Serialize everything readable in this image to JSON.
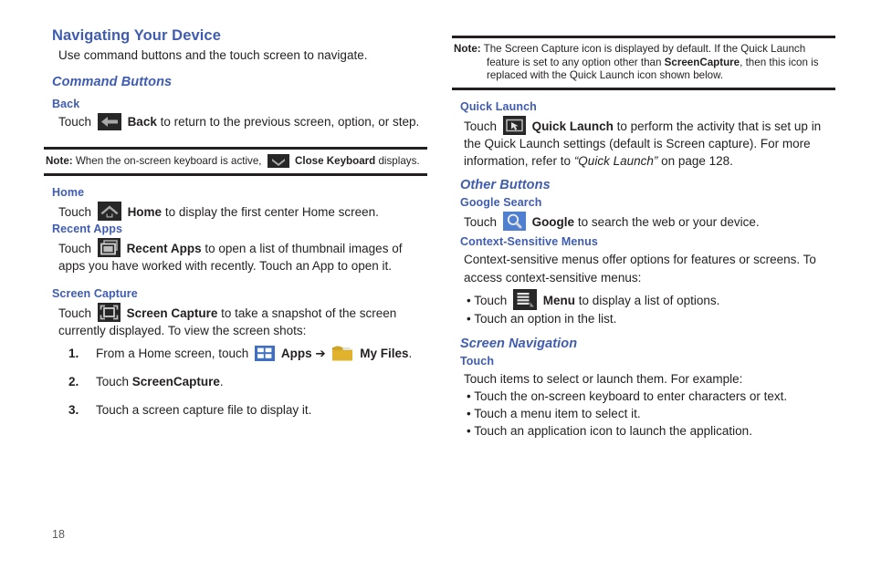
{
  "page": {
    "number": "18"
  },
  "left_column": {
    "title": "Navigating Your Device",
    "intro": "Use command buttons and the touch screen to navigate.",
    "command_buttons_heading": "Command Buttons",
    "back": {
      "heading": "Back",
      "touch_label": "Touch",
      "icon": "back-arrow-icon",
      "bold_name": "Back",
      "rest": " to return to the previous screen, option, or step."
    },
    "note_keyboard": {
      "label": "Note:",
      "text_before": "When the on-screen keyboard is active,",
      "icon": "close-keyboard-chevron-icon",
      "bold_name": "Close Keyboard",
      "text_after": "displays."
    },
    "home": {
      "heading": "Home",
      "touch_label": "Touch",
      "icon": "home-icon",
      "bold_name": "Home",
      "rest": " to display the first center Home screen."
    },
    "recent_apps": {
      "heading": "Recent Apps",
      "touch_label": "Touch",
      "icon": "recent-apps-icon",
      "bold_name": "Recent Apps",
      "rest": " to open a list of thumbnail images of apps you have worked with recently. Touch an App to open it."
    },
    "screen_capture": {
      "heading": "Screen Capture",
      "touch_label": "Touch",
      "icon": "screen-capture-icon",
      "bold_name": "Screen Capture",
      "rest": " to take a snapshot of the screen currently displayed. To view the screen shots:",
      "steps": [
        {
          "num": "1.",
          "text_before": "From a Home screen, touch",
          "icon1": "apps-grid-icon",
          "bold1": "Apps",
          "arrow": "➔",
          "icon2": "my-files-folder-icon",
          "bold2": "My Files",
          "text_after": "."
        },
        {
          "num": "2.",
          "text_before": "Touch",
          "bold1": "ScreenCapture",
          "text_after": "."
        },
        {
          "num": "3.",
          "text_before": "Touch a screen capture file to display it.",
          "bold1": "",
          "text_after": ""
        }
      ]
    }
  },
  "right_column": {
    "note_screen_capture": {
      "label": "Note:",
      "part1": "The Screen Capture icon is displayed by default. If the Quick Launch feature is set to any option other than ",
      "bold1": "ScreenCapture",
      "part2": ", then this icon is replaced with the Quick Launch icon shown below."
    },
    "quick_launch": {
      "heading": "Quick Launch",
      "touch_label": "Touch",
      "icon": "quick-launch-icon",
      "bold_name": "Quick Launch",
      "rest_part1": " to perform the activity that is set up in the Quick Launch settings (default is Screen capture). For more information, refer to ",
      "italic_ref": "“Quick Launch”",
      "rest_part2": " on page 128."
    },
    "other_buttons_heading": "Other Buttons",
    "google_search": {
      "heading": "Google Search",
      "touch_label": "Touch",
      "icon": "google-search-icon",
      "bold_name": "Google",
      "rest": " to search the web or your device."
    },
    "context_menus": {
      "heading": "Context-Sensitive Menus",
      "intro": "Context-sensitive menus offer options for features or screens. To access context-sensitive menus:",
      "bullets": [
        {
          "text_before": "• Touch",
          "icon": "menu-icon",
          "bold": "Menu",
          "text_after": " to display a list of options."
        },
        {
          "text_before": "• Touch an option in the list.",
          "icon": "",
          "bold": "",
          "text_after": ""
        }
      ]
    },
    "screen_navigation_heading": "Screen Navigation",
    "touch_section": {
      "heading": "Touch",
      "intro": "Touch items to select or launch them. For example:",
      "bullets": [
        "• Touch the on-screen keyboard to enter characters or text.",
        "• Touch a menu item to select it.",
        "• Touch an application icon to launch the application."
      ]
    }
  },
  "colors": {
    "heading_blue": "#3f5cb0",
    "body_black": "#231f20",
    "icon_dark": "#272727",
    "icon_gray": "#a8a8a8",
    "apps_blue": "#3f6fc4",
    "folder_yellow": "#e0b22e"
  }
}
